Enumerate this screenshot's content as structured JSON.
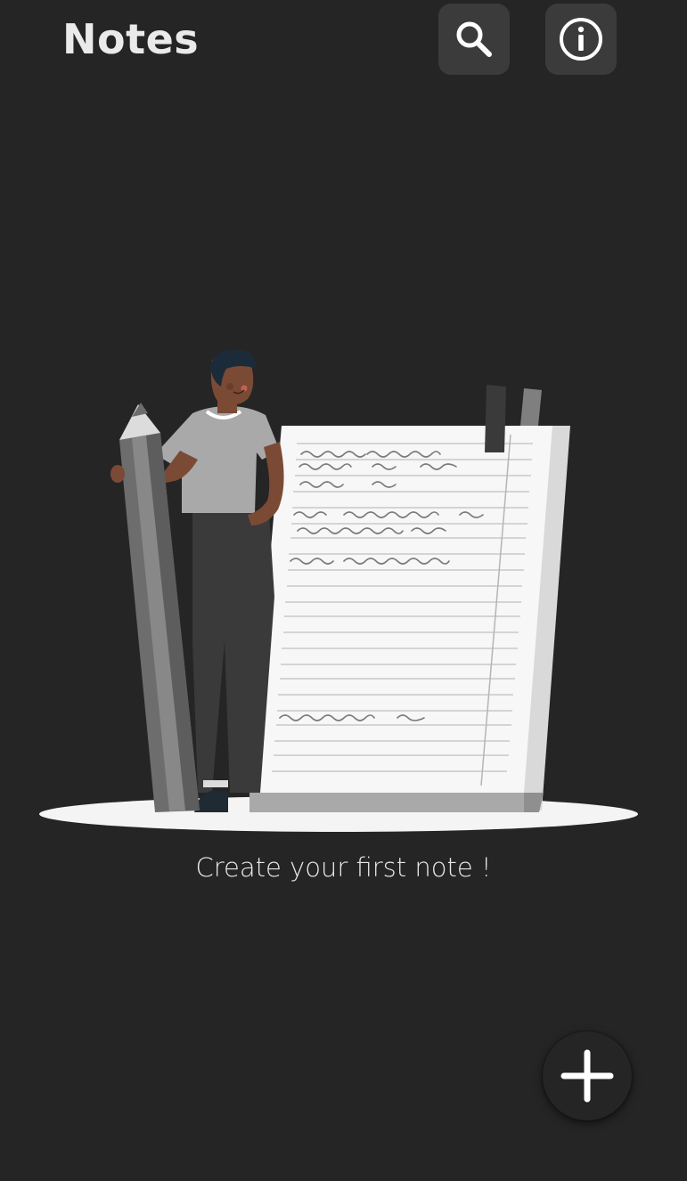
{
  "header": {
    "title": "Notes",
    "search_icon": "search-icon",
    "info_icon": "info-icon"
  },
  "empty_state": {
    "illustration": "person-with-pencil-and-notepad-illustration",
    "message": "Create your first note !"
  },
  "fab": {
    "icon": "plus-icon"
  },
  "colors": {
    "background": "#252525",
    "button_background": "#3b3b3b",
    "text": "#eaeaea"
  }
}
